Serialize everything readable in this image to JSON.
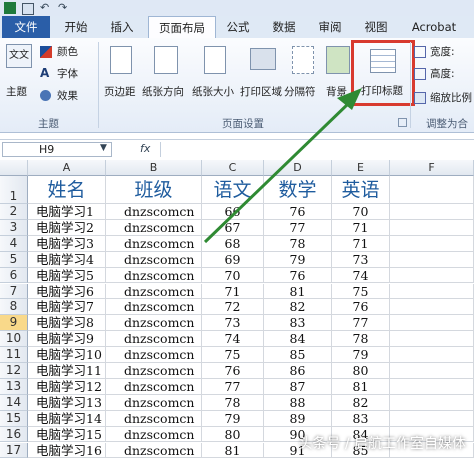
{
  "tabs": [
    "文件",
    "开始",
    "插入",
    "页面布局",
    "公式",
    "数据",
    "审阅",
    "视图",
    "Acrobat"
  ],
  "ribbon": {
    "theme": {
      "main_label": "主题",
      "colors_label": "颜色",
      "fonts_label": "字体",
      "effects_label": "效果",
      "group_label": "主题"
    },
    "page_setup": {
      "margins_label": "页边距",
      "orientation_label": "纸张方向",
      "size_label": "纸张大小",
      "print_area_label": "打印区域",
      "breaks_label": "分隔符",
      "background_label": "背景",
      "print_titles_label": "打印标题",
      "group_label": "页面设置"
    },
    "scale": {
      "width_label": "宽度:",
      "height_label": "高度:",
      "scale_label": "缩放比例",
      "group_label": "调整为合"
    }
  },
  "formula_bar": {
    "name_box": "H9"
  },
  "columns": [
    "A",
    "B",
    "C",
    "D",
    "E",
    "F"
  ],
  "header_row": [
    "姓名",
    "班级",
    "语文",
    "数学",
    "英语"
  ],
  "rows": [
    {
      "n": "2",
      "name": "电脑学习1",
      "cls": "dnzscomcn",
      "c": "66",
      "m": "76",
      "e": "70"
    },
    {
      "n": "3",
      "name": "电脑学习2",
      "cls": "dnzscomcn",
      "c": "67",
      "m": "77",
      "e": "71"
    },
    {
      "n": "4",
      "name": "电脑学习3",
      "cls": "dnzscomcn",
      "c": "68",
      "m": "78",
      "e": "71"
    },
    {
      "n": "5",
      "name": "电脑学习4",
      "cls": "dnzscomcn",
      "c": "69",
      "m": "79",
      "e": "73"
    },
    {
      "n": "6",
      "name": "电脑学习5",
      "cls": "dnzscomcn",
      "c": "70",
      "m": "76",
      "e": "74"
    },
    {
      "n": "7",
      "name": "电脑学习6",
      "cls": "dnzscomcn",
      "c": "71",
      "m": "81",
      "e": "75"
    },
    {
      "n": "8",
      "name": "电脑学习7",
      "cls": "dnzscomcn",
      "c": "72",
      "m": "82",
      "e": "76"
    },
    {
      "n": "9",
      "name": "电脑学习8",
      "cls": "dnzscomcn",
      "c": "73",
      "m": "83",
      "e": "77"
    },
    {
      "n": "10",
      "name": "电脑学习9",
      "cls": "dnzscomcn",
      "c": "74",
      "m": "84",
      "e": "78"
    },
    {
      "n": "11",
      "name": "电脑学习10",
      "cls": "dnzscomcn",
      "c": "75",
      "m": "85",
      "e": "79"
    },
    {
      "n": "12",
      "name": "电脑学习11",
      "cls": "dnzscomcn",
      "c": "76",
      "m": "86",
      "e": "80"
    },
    {
      "n": "13",
      "name": "电脑学习12",
      "cls": "dnzscomcn",
      "c": "77",
      "m": "87",
      "e": "81"
    },
    {
      "n": "14",
      "name": "电脑学习13",
      "cls": "dnzscomcn",
      "c": "78",
      "m": "88",
      "e": "82"
    },
    {
      "n": "15",
      "name": "电脑学习14",
      "cls": "dnzscomcn",
      "c": "79",
      "m": "89",
      "e": "83"
    },
    {
      "n": "16",
      "name": "电脑学习15",
      "cls": "dnzscomcn",
      "c": "80",
      "m": "90",
      "e": "84"
    },
    {
      "n": "17",
      "name": "电脑学习16",
      "cls": "dnzscomcn",
      "c": "81",
      "m": "91",
      "e": "85"
    }
  ],
  "first_row_num": "1",
  "selected_row": "9",
  "watermark": "头条号 / 启航工作室自媒体",
  "colors": {
    "accent": "#2a5ea8",
    "highlight_box": "#d83a2f",
    "arrow": "#2f8a33",
    "header_text": "#1f5c9e"
  }
}
